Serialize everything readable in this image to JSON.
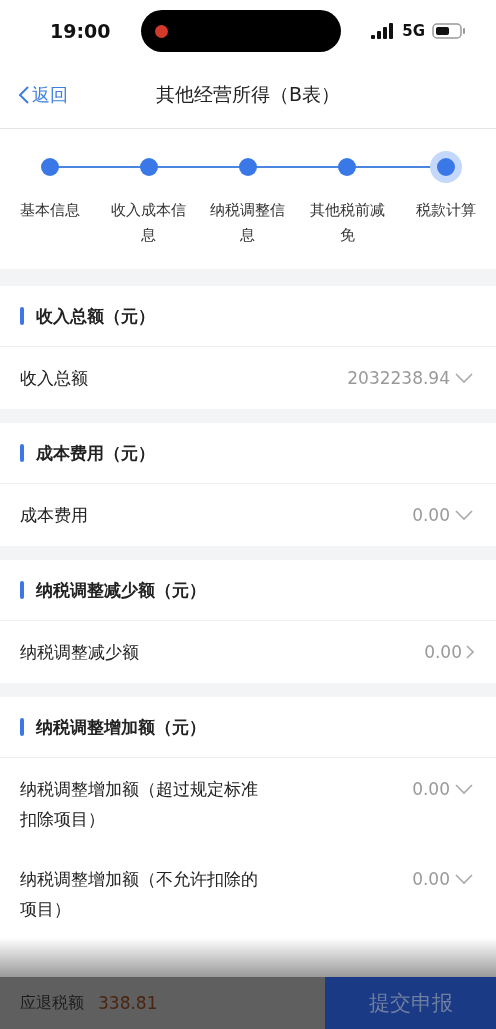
{
  "status_bar": {
    "time": "19:00",
    "network": "5G"
  },
  "nav": {
    "back": "返回",
    "title": "其他经营所得（B表）"
  },
  "steps": [
    {
      "label": "基本信息",
      "selected": false
    },
    {
      "label": "收入成本信息",
      "selected": false
    },
    {
      "label": "纳税调整信息",
      "selected": false
    },
    {
      "label": "其他税前减免",
      "selected": false
    },
    {
      "label": "税款计算",
      "selected": true
    }
  ],
  "sections": [
    {
      "title": "收入总额（元）",
      "rows": [
        {
          "label": "收入总额",
          "value": "2032238.94",
          "kind": "dropdown"
        }
      ]
    },
    {
      "title": "成本费用（元）",
      "rows": [
        {
          "label": "成本费用",
          "value": "0.00",
          "kind": "dropdown"
        }
      ]
    },
    {
      "title": "纳税调整减少额（元）",
      "rows": [
        {
          "label": "纳税调整减少额",
          "value": "0.00",
          "kind": "link"
        }
      ]
    },
    {
      "title": "纳税调整增加额（元）",
      "rows": [
        {
          "label": "纳税调整增加额（超过规定标准扣除项目）",
          "value": "0.00",
          "kind": "dropdown"
        },
        {
          "label": "纳税调整增加额（不允许扣除的项目）",
          "value": "0.00",
          "kind": "dropdown"
        }
      ]
    }
  ],
  "footer": {
    "label": "应退税额",
    "amount": "338.81",
    "button": "提交申报"
  }
}
